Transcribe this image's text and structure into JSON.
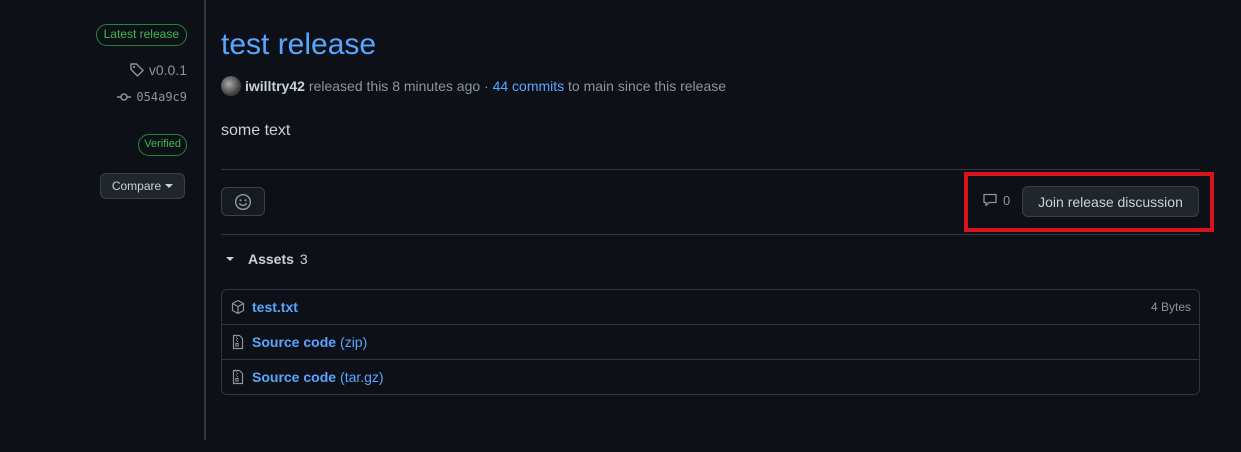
{
  "sidebar": {
    "latest_badge": "Latest release",
    "tag": "v0.0.1",
    "commit": "054a9c9",
    "verified_badge": "Verified",
    "compare_label": "Compare"
  },
  "release": {
    "title": "test release",
    "author": "iwilltry42",
    "released_text": "released this 8 minutes ago ·",
    "commits_link": "44 commits",
    "since_text": "to main since this release",
    "body": "some text"
  },
  "discussion": {
    "comment_count": "0",
    "join_label": "Join release discussion"
  },
  "assets": {
    "label": "Assets",
    "count": "3",
    "items": [
      {
        "name": "test.txt",
        "ext": "",
        "size": "4 Bytes",
        "icon": "package-icon"
      },
      {
        "name": "Source code",
        "ext": "(zip)",
        "size": "",
        "icon": "file-zip-icon"
      },
      {
        "name": "Source code",
        "ext": "(tar.gz)",
        "size": "",
        "icon": "file-zip-icon"
      }
    ]
  },
  "colors": {
    "link": "#58a6ff",
    "success": "#3fb950",
    "highlight": "#d5141b"
  }
}
